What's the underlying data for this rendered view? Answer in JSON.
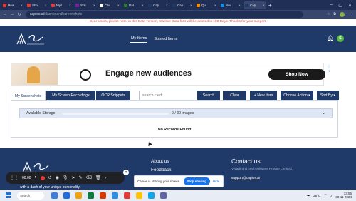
{
  "browser": {
    "tabs": [
      {
        "label": "Hea",
        "color": "#e53935"
      },
      {
        "label": "Sho",
        "color": "#e53935"
      },
      {
        "label": "My l",
        "color": "#e53935"
      },
      {
        "label": "Spli",
        "color": "#7b1fa2"
      },
      {
        "label": "Cha",
        "color": "#ffffff"
      },
      {
        "label": "Dat",
        "color": "#2e7d32"
      },
      {
        "label": "Cap",
        "color": "#1f3a68"
      },
      {
        "label": "Cap",
        "color": "#1f3a68"
      },
      {
        "label": "Qui",
        "color": "#fb8c00"
      },
      {
        "label": "Nev",
        "color": "#1e88e5"
      },
      {
        "label": "Cap",
        "color": "#1f3a68"
      }
    ],
    "active_tab_index": 10,
    "new_tab_label": "+",
    "url_host": "capios.ai",
    "url_path": "/dashboard/screenshots",
    "profile_initial": ""
  },
  "notice": "Dear Users, please note: in this Beta version, Inactive Data files will be deleted in 180 Days. Thanks for your support.",
  "header": {
    "menu": [
      {
        "label": "My Items",
        "active": true
      },
      {
        "label": "Starred Items",
        "active": false
      }
    ],
    "avatar_initial": "S"
  },
  "ad": {
    "headline": "Engage new audiences",
    "cta": "Shop Now",
    "info": "ⓘ ✕"
  },
  "toolbar": {
    "tabs": [
      "My Screenshots",
      "My Screen Recordings",
      "OCR Snippets"
    ],
    "active_tab": 0,
    "search_placeholder": "search card",
    "search_button": "Search",
    "clear_button": "Clear",
    "new_item_button": "+ New Item",
    "choose_action": "Choose Action ▾",
    "sort_by": "Sort By ▾"
  },
  "storage": {
    "label": "Available Storage",
    "used": 0,
    "total": 30,
    "count_text": "0 / 30 images"
  },
  "empty_state": "No Records Found!",
  "footer": {
    "tagline": "with a dash of your unique personality.",
    "about": "About us",
    "feedback": "Feedback",
    "contact_title": "Contact us",
    "company": "Vivadmind Technologies Private Limited",
    "email": "support@capios.ai"
  },
  "share_bar": {
    "text": "Capios is sharing your screen.",
    "stop": "Stop sharing",
    "hide": "Hide"
  },
  "recorder": {
    "time": "00:00"
  },
  "taskbar": {
    "search": "Search",
    "weather": "28°C",
    "time": "13:56",
    "date": "30-11-2024",
    "icon_colors": [
      "#3b7dd8",
      "#1e6fd9",
      "#f0a30a",
      "#0f7b3e",
      "#d83b01",
      "#2f8ee0",
      "#e53935",
      "#ffc400",
      "#0ea5e9",
      "#6264a7"
    ]
  },
  "colors": {
    "brand": "#1f3a68",
    "notice": "#d9534f",
    "storage_fill": "#2f6fc5"
  }
}
